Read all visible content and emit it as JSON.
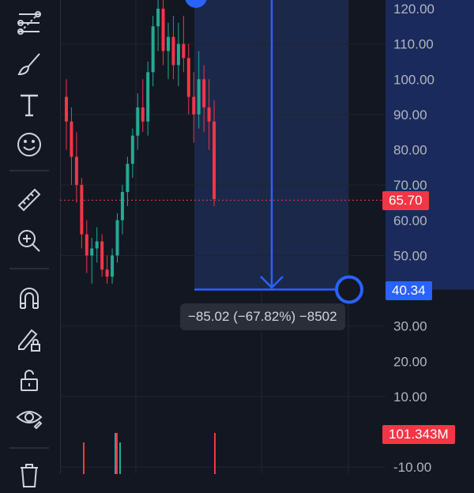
{
  "toolbar": {
    "icons": [
      "trend-line-tools-icon",
      "brush-icon",
      "text-icon",
      "emoji-icon",
      "ruler-icon",
      "zoom-in-icon",
      "magnet-icon",
      "lock-drawing-icon",
      "unlock-icon",
      "eye-icon",
      "trash-icon"
    ]
  },
  "price_axis": {
    "ticks": [
      "120.00",
      "110.00",
      "100.00",
      "90.00",
      "80.00",
      "70.00",
      "60.00",
      "50.00",
      "40.00",
      "30.00",
      "20.00",
      "10.00",
      "-10.00"
    ]
  },
  "current_price": {
    "label": "65.70",
    "color": "#f23645"
  },
  "measure_price": {
    "label": "40.34",
    "color": "#2962ff"
  },
  "volume_label": {
    "label": "101.343M",
    "color": "#f23645"
  },
  "measurement": {
    "text": "−85.02 (−67.82%) −8502"
  },
  "colors": {
    "up": "#22ab94",
    "down": "#f23645",
    "measure": "#2962ff",
    "background": "#131722"
  },
  "chart_data": {
    "type": "candlestick",
    "price_range": [
      -10,
      125
    ],
    "candles": [
      [
        95,
        100,
        80,
        88
      ],
      [
        88,
        92,
        70,
        78
      ],
      [
        78,
        85,
        65,
        70
      ],
      [
        70,
        72,
        52,
        56
      ],
      [
        56,
        60,
        45,
        50
      ],
      [
        50,
        55,
        42,
        52
      ],
      [
        52,
        58,
        48,
        54
      ],
      [
        54,
        56,
        44,
        46
      ],
      [
        46,
        50,
        42,
        44
      ],
      [
        44,
        52,
        42,
        50
      ],
      [
        50,
        62,
        48,
        60
      ],
      [
        60,
        70,
        56,
        68
      ],
      [
        68,
        78,
        64,
        76
      ],
      [
        76,
        86,
        72,
        84
      ],
      [
        84,
        96,
        80,
        92
      ],
      [
        92,
        100,
        85,
        88
      ],
      [
        88,
        105,
        84,
        102
      ],
      [
        102,
        118,
        98,
        115
      ],
      [
        115,
        125,
        108,
        120
      ],
      [
        120,
        124,
        104,
        108
      ],
      [
        108,
        116,
        100,
        112
      ],
      [
        112,
        118,
        100,
        104
      ],
      [
        104,
        116,
        98,
        110
      ],
      [
        110,
        118,
        102,
        106
      ],
      [
        106,
        110,
        90,
        95
      ],
      [
        95,
        102,
        82,
        90
      ],
      [
        90,
        108,
        86,
        100
      ],
      [
        100,
        104,
        85,
        92
      ],
      [
        92,
        100,
        80,
        88
      ],
      [
        88,
        94,
        64,
        66
      ]
    ]
  }
}
